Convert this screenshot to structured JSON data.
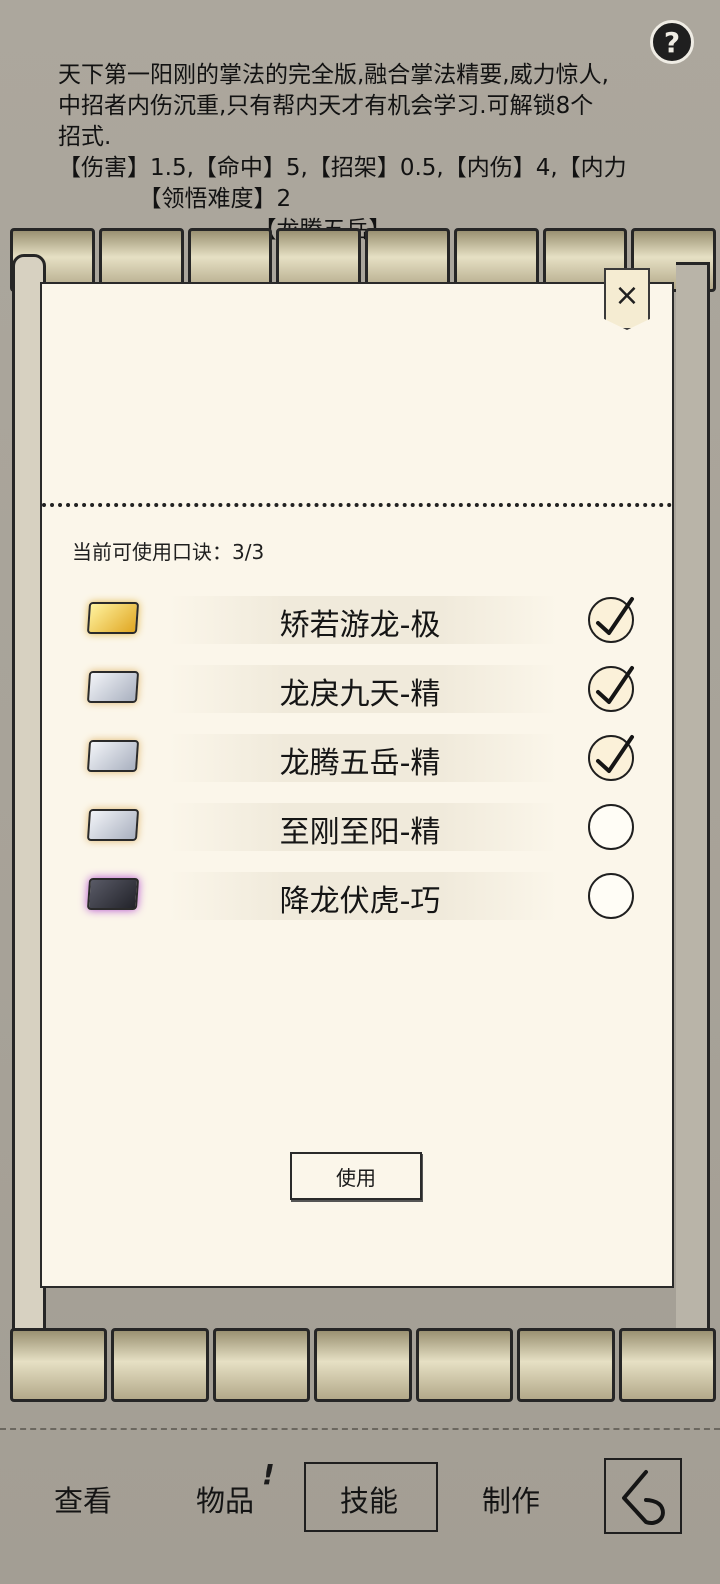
{
  "description": {
    "lines": [
      "天下第一阳刚的掌法的完全版,融合掌法精要,威力惊人,",
      "中招者内伤沉重,只有帮内天才有机会学习.可解锁8个",
      "招式.",
      "【伤害】1.5,【命中】5,【招架】0.5,【内伤】4,【内力",
      "　　　　【领悟难度】2",
      "　　　　　　　　　【龙腾五岳】"
    ]
  },
  "dialog": {
    "close_icon": "×",
    "count_label": "当前可使用口诀：",
    "count_value": "3/3",
    "items": [
      {
        "label": "矫若游龙-极",
        "tier": "gold",
        "checked": true
      },
      {
        "label": "龙戾九天-精",
        "tier": "silver",
        "checked": true
      },
      {
        "label": "龙腾五岳-精",
        "tier": "silver",
        "checked": true
      },
      {
        "label": "至刚至阳-精",
        "tier": "silver",
        "checked": false
      },
      {
        "label": "降龙伏虎-巧",
        "tier": "dark",
        "checked": false
      }
    ],
    "use_button": "使用"
  },
  "nav": {
    "view": "查看",
    "items": "物品",
    "items_badge": "!",
    "skills": "技能",
    "craft": "制作"
  },
  "help_icon": "?"
}
